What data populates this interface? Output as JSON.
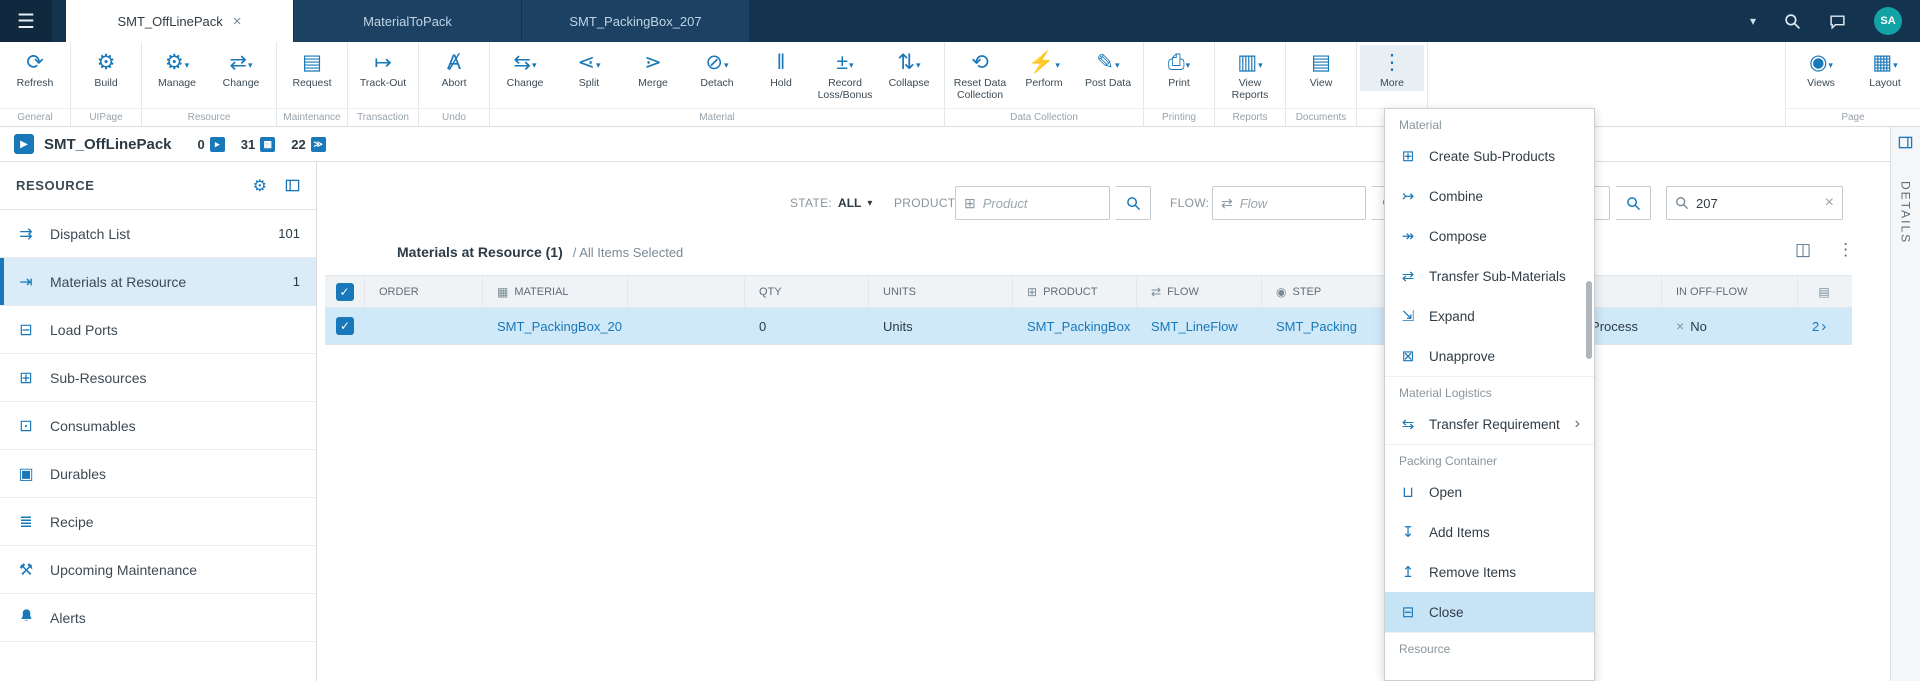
{
  "topbar": {
    "hamburger_icon": "☰",
    "tabs": [
      {
        "label": "SMT_OffLinePack",
        "close_icon": "×"
      },
      {
        "label": "MaterialToPack"
      },
      {
        "label": "SMT_PackingBox_207"
      }
    ],
    "caret_icon": "▾",
    "avatar": "SA"
  },
  "toolbar": {
    "groups": [
      {
        "label": "General",
        "buttons": [
          {
            "label": "Refresh",
            "icon": "⟳"
          }
        ]
      },
      {
        "label": "UIPage",
        "buttons": [
          {
            "label": "Build",
            "icon": "⚙"
          }
        ]
      },
      {
        "label": "Resource",
        "buttons": [
          {
            "label": "Manage",
            "icon": "⚙"
          },
          {
            "label": "Change",
            "icon": "⇄"
          }
        ]
      },
      {
        "label": "Maintenance",
        "buttons": [
          {
            "label": "Request",
            "icon": "▤"
          }
        ]
      },
      {
        "label": "Transaction",
        "buttons": [
          {
            "label": "Track-Out",
            "icon": "↦"
          }
        ]
      },
      {
        "label": "Undo",
        "buttons": [
          {
            "label": "Abort",
            "icon": "Ⱥ"
          }
        ]
      },
      {
        "label": "Material",
        "buttons": [
          {
            "label": "Change",
            "icon": "⇆"
          },
          {
            "label": "Split",
            "icon": "⋖"
          },
          {
            "label": "Merge",
            "icon": "⋗"
          },
          {
            "label": "Detach",
            "icon": "⊘"
          },
          {
            "label": "Hold",
            "icon": "‖"
          },
          {
            "label": "Record Loss/Bonus",
            "icon": "±"
          },
          {
            "label": "Collapse",
            "icon": "⇅"
          }
        ]
      },
      {
        "label": "Data Collection",
        "buttons": [
          {
            "label": "Reset Data Collection",
            "icon": "⟲"
          },
          {
            "label": "Perform",
            "icon": "⚡"
          },
          {
            "label": "Post Data",
            "icon": "✎"
          }
        ]
      },
      {
        "label": "Printing",
        "buttons": [
          {
            "label": "Print",
            "icon": "⎙"
          }
        ]
      },
      {
        "label": "Reports",
        "buttons": [
          {
            "label": "View Reports",
            "icon": "▥"
          }
        ]
      },
      {
        "label": "Documents",
        "buttons": [
          {
            "label": "View",
            "icon": "▤"
          }
        ]
      },
      {
        "label": "",
        "buttons": [
          {
            "label": "More",
            "icon": "⋮"
          }
        ]
      }
    ],
    "page_group": {
      "label": "Page",
      "buttons": [
        {
          "label": "Views",
          "icon": "◉"
        },
        {
          "label": "Layout",
          "icon": "▦"
        }
      ]
    }
  },
  "subheader": {
    "title": "SMT_OffLinePack",
    "counters": [
      {
        "value": "0",
        "icon": "▸"
      },
      {
        "value": "31",
        "icon": "▦"
      },
      {
        "value": "22",
        "icon": "≫"
      }
    ]
  },
  "sidebar": {
    "title": "RESOURCE",
    "gear_icon": "⚙",
    "items": [
      {
        "label": "Dispatch List",
        "icon": "⇉",
        "count": "101"
      },
      {
        "label": "Materials at Resource",
        "icon": "⇥",
        "count": "1"
      },
      {
        "label": "Load Ports",
        "icon": "⊟",
        "count": ""
      },
      {
        "label": "Sub-Resources",
        "icon": "⊞",
        "count": ""
      },
      {
        "label": "Consumables",
        "icon": "⊡",
        "count": ""
      },
      {
        "label": "Durables",
        "icon": "▣",
        "count": ""
      },
      {
        "label": "Recipe",
        "icon": "≣",
        "count": ""
      },
      {
        "label": "Upcoming Maintenance",
        "icon": "⚒",
        "count": ""
      },
      {
        "label": "Alerts",
        "icon": "",
        "count": ""
      }
    ]
  },
  "filters": {
    "state_label": "STATE:",
    "state_value": "ALL",
    "product_label": "PRODUCT:",
    "product_placeholder": "Product",
    "product_icon": "⊞",
    "flow_label": "FLOW:",
    "flow_placeholder": "Flow",
    "flow_icon": "⇄",
    "quick_value": "207",
    "clear_icon": "×"
  },
  "list": {
    "title": "Materials at Resource (1)",
    "subtitle": "/  All Items Selected",
    "columns": [
      {
        "label": "ORDER",
        "icon": ""
      },
      {
        "label": "MATERIAL",
        "icon": "▦"
      },
      {
        "label": "",
        "icon": ""
      },
      {
        "label": "QTY",
        "icon": ""
      },
      {
        "label": "UNITS",
        "icon": ""
      },
      {
        "label": "PRODUCT",
        "icon": "⊞"
      },
      {
        "label": "FLOW",
        "icon": "⇄"
      },
      {
        "label": "STEP",
        "icon": "◉"
      },
      {
        "label": "",
        "icon": ""
      },
      {
        "label": "IN OFF-FLOW",
        "icon": ""
      },
      {
        "label": "",
        "icon": "▤"
      }
    ],
    "rows": [
      {
        "order": "",
        "material": "SMT_PackingBox_20",
        "qty": "0",
        "units": "Units",
        "product": "SMT_PackingBox",
        "flow": "SMT_LineFlow",
        "step": "SMT_Packing",
        "state": "In Process",
        "in_off_flow": "No",
        "off_flow_icon": "×",
        "details_count": "2"
      }
    ]
  },
  "menu": {
    "sections": [
      {
        "header": "Material",
        "items": [
          {
            "label": "Create Sub-Products",
            "icon": "⊞"
          },
          {
            "label": "Combine",
            "icon": "↣"
          },
          {
            "label": "Compose",
            "icon": "↠"
          },
          {
            "label": "Transfer Sub-Materials",
            "icon": "⇄"
          },
          {
            "label": "Expand",
            "icon": "⇲"
          },
          {
            "label": "Unapprove",
            "icon": "⊠"
          }
        ]
      },
      {
        "header": "Material Logistics",
        "items": [
          {
            "label": "Transfer Requirement",
            "icon": "⇆",
            "submenu": "›"
          }
        ]
      },
      {
        "header": "Packing Container",
        "items": [
          {
            "label": "Open",
            "icon": "⊔"
          },
          {
            "label": "Add Items",
            "icon": "↧"
          },
          {
            "label": "Remove Items",
            "icon": "↥"
          },
          {
            "label": "Close",
            "icon": "⊟"
          }
        ]
      },
      {
        "header": "Resource",
        "items": []
      }
    ]
  },
  "details_panel": {
    "label": "DETAILS"
  }
}
